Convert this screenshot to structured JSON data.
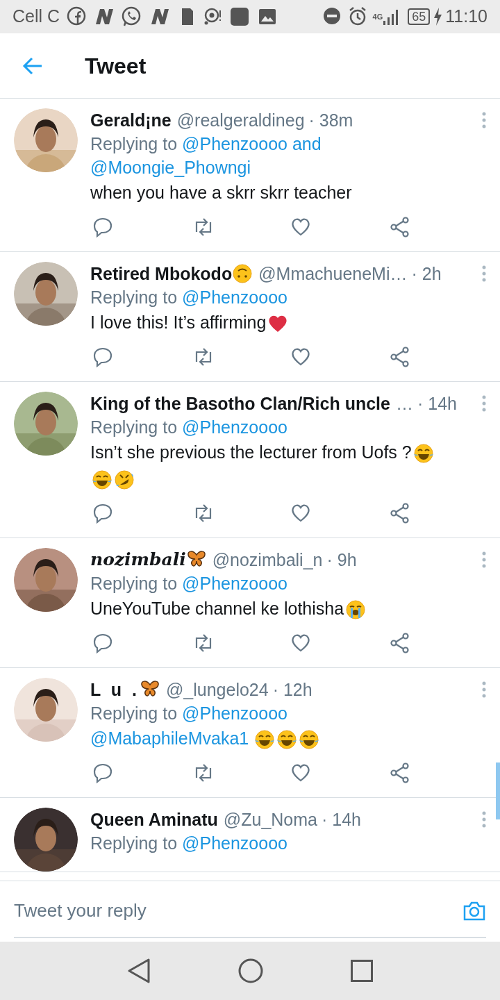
{
  "status_bar": {
    "carrier": "Cell C",
    "network": "4G",
    "battery": "65",
    "time": "11:10"
  },
  "header": {
    "title": "Tweet"
  },
  "tweets": [
    {
      "name": [
        {
          "kind": "text",
          "text": "Gerald¡ne"
        }
      ],
      "handle": "@realgeraldineg",
      "time": "· 38m",
      "replying": {
        "prefix": "Replying to",
        "targets": [
          "@Phenzoooo and",
          "@Moongie_Phowngi"
        ]
      },
      "body": [
        {
          "kind": "text",
          "text": "when you have a skrr skrr teacher"
        }
      ]
    },
    {
      "name": [
        {
          "kind": "text",
          "text": "Retired Mbokodo"
        },
        {
          "kind": "upside"
        }
      ],
      "handle": "@MmachueneMi…",
      "time": "· 2h",
      "replying": {
        "prefix": "Replying to",
        "targets": [
          "@Phenzoooo"
        ]
      },
      "body": [
        {
          "kind": "text",
          "text": "I love this! It’s affirming"
        },
        {
          "kind": "heart"
        }
      ]
    },
    {
      "name": [
        {
          "kind": "text",
          "text": "King of the Basotho Clan/Rich uncle"
        }
      ],
      "handle": "…",
      "time": "· 14h",
      "replying": {
        "prefix": "Replying to",
        "targets": [
          "@Phenzoooo"
        ]
      },
      "body": [
        {
          "kind": "text",
          "text": "Isn’t she previous the lecturer from Uofs  ?"
        },
        {
          "kind": "joy"
        },
        {
          "kind": "break"
        },
        {
          "kind": "joy"
        },
        {
          "kind": "rofl"
        }
      ]
    },
    {
      "name": [
        {
          "kind": "blackletter",
          "text": "nozimbali"
        },
        {
          "kind": "butterfly"
        }
      ],
      "handle": "@nozimbali_n",
      "time": "· 9h",
      "replying": {
        "prefix": "Replying to",
        "targets": [
          "@Phenzoooo"
        ]
      },
      "body": [
        {
          "kind": "text",
          "text": "UneYouTube channel ke lothisha"
        },
        {
          "kind": "sob"
        }
      ]
    },
    {
      "name": [
        {
          "kind": "spaced",
          "text": "L u ."
        },
        {
          "kind": "butterfly"
        }
      ],
      "handle": "@_lungelo24",
      "time": "· 12h",
      "replying": {
        "prefix": "Replying to",
        "targets": [
          "@Phenzoooo"
        ]
      },
      "body": [
        {
          "kind": "mention",
          "text": "@MabaphileMvaka1"
        },
        {
          "kind": "joy"
        },
        {
          "kind": "joy"
        },
        {
          "kind": "joy"
        }
      ]
    },
    {
      "name": [
        {
          "kind": "text",
          "text": "Queen Aminatu"
        }
      ],
      "handle": "@Zu_Noma",
      "time": "· 14h",
      "replying": {
        "prefix": "Replying to",
        "targets": [
          "@Phenzoooo"
        ]
      }
    }
  ],
  "reply_bar": {
    "placeholder": "Tweet your reply"
  }
}
